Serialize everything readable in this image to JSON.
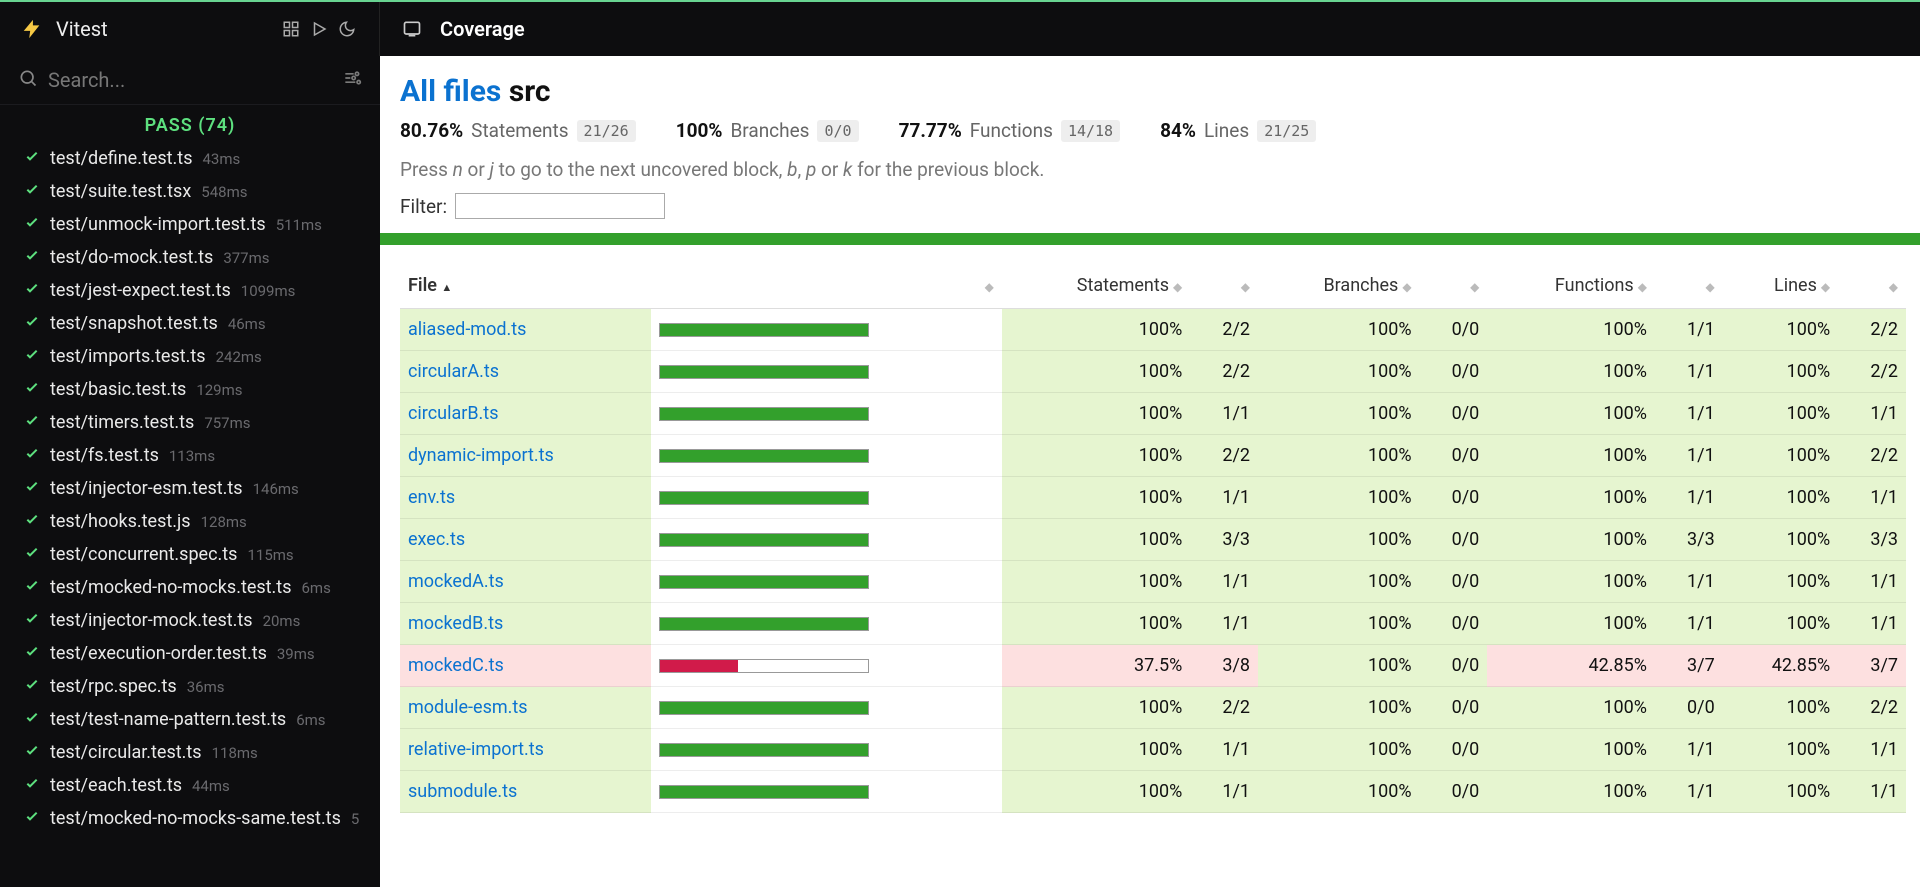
{
  "brand": {
    "name": "Vitest"
  },
  "topbar": {
    "coverage_label": "Coverage"
  },
  "search": {
    "placeholder": "Search..."
  },
  "status": {
    "text": "PASS (74)"
  },
  "tests": [
    {
      "path": "test/define.test.ts",
      "dur": "43ms"
    },
    {
      "path": "test/suite.test.tsx",
      "dur": "548ms"
    },
    {
      "path": "test/unmock-import.test.ts",
      "dur": "511ms"
    },
    {
      "path": "test/do-mock.test.ts",
      "dur": "377ms"
    },
    {
      "path": "test/jest-expect.test.ts",
      "dur": "1099ms"
    },
    {
      "path": "test/snapshot.test.ts",
      "dur": "46ms"
    },
    {
      "path": "test/imports.test.ts",
      "dur": "242ms"
    },
    {
      "path": "test/basic.test.ts",
      "dur": "129ms"
    },
    {
      "path": "test/timers.test.ts",
      "dur": "757ms"
    },
    {
      "path": "test/fs.test.ts",
      "dur": "113ms"
    },
    {
      "path": "test/injector-esm.test.ts",
      "dur": "146ms"
    },
    {
      "path": "test/hooks.test.js",
      "dur": "128ms"
    },
    {
      "path": "test/concurrent.spec.ts",
      "dur": "115ms"
    },
    {
      "path": "test/mocked-no-mocks.test.ts",
      "dur": "6ms"
    },
    {
      "path": "test/injector-mock.test.ts",
      "dur": "20ms"
    },
    {
      "path": "test/execution-order.test.ts",
      "dur": "39ms"
    },
    {
      "path": "test/rpc.spec.ts",
      "dur": "36ms"
    },
    {
      "path": "test/test-name-pattern.test.ts",
      "dur": "6ms"
    },
    {
      "path": "test/circular.test.ts",
      "dur": "118ms"
    },
    {
      "path": "test/each.test.ts",
      "dur": "44ms"
    },
    {
      "path": "test/mocked-no-mocks-same.test.ts",
      "dur": "5"
    }
  ],
  "crumb": {
    "root": "All files",
    "sub": "src"
  },
  "summary": {
    "statements": {
      "pct": "80.76%",
      "label": "Statements",
      "frac": "21/26"
    },
    "branches": {
      "pct": "100%",
      "label": "Branches",
      "frac": "0/0"
    },
    "functions": {
      "pct": "77.77%",
      "label": "Functions",
      "frac": "14/18"
    },
    "lines": {
      "pct": "84%",
      "label": "Lines",
      "frac": "21/25"
    }
  },
  "hint": {
    "prefix": "Press ",
    "k_next1": "n",
    "or1": " or ",
    "k_next2": "j",
    "mid": " to go to the next uncovered block, ",
    "k_prev1": "b",
    "comma": ", ",
    "k_prev2": "p",
    "or2": " or ",
    "k_prev3": "k",
    "suffix": " for the previous block."
  },
  "filter": {
    "label": "Filter:"
  },
  "headers": {
    "file": "File",
    "statements": "Statements",
    "branches": "Branches",
    "functions": "Functions",
    "lines": "Lines"
  },
  "rows": [
    {
      "file": "aliased-mod.ts",
      "stPct": "100%",
      "stBar": 100,
      "stFrac": "2/2",
      "brPct": "100%",
      "brFrac": "0/0",
      "fnPct": "100%",
      "fnFrac": "1/1",
      "lnPct": "100%",
      "lnFrac": "2/2",
      "low": false
    },
    {
      "file": "circularA.ts",
      "stPct": "100%",
      "stBar": 100,
      "stFrac": "2/2",
      "brPct": "100%",
      "brFrac": "0/0",
      "fnPct": "100%",
      "fnFrac": "1/1",
      "lnPct": "100%",
      "lnFrac": "2/2",
      "low": false
    },
    {
      "file": "circularB.ts",
      "stPct": "100%",
      "stBar": 100,
      "stFrac": "1/1",
      "brPct": "100%",
      "brFrac": "0/0",
      "fnPct": "100%",
      "fnFrac": "1/1",
      "lnPct": "100%",
      "lnFrac": "1/1",
      "low": false
    },
    {
      "file": "dynamic-import.ts",
      "stPct": "100%",
      "stBar": 100,
      "stFrac": "2/2",
      "brPct": "100%",
      "brFrac": "0/0",
      "fnPct": "100%",
      "fnFrac": "1/1",
      "lnPct": "100%",
      "lnFrac": "2/2",
      "low": false
    },
    {
      "file": "env.ts",
      "stPct": "100%",
      "stBar": 100,
      "stFrac": "1/1",
      "brPct": "100%",
      "brFrac": "0/0",
      "fnPct": "100%",
      "fnFrac": "1/1",
      "lnPct": "100%",
      "lnFrac": "1/1",
      "low": false
    },
    {
      "file": "exec.ts",
      "stPct": "100%",
      "stBar": 100,
      "stFrac": "3/3",
      "brPct": "100%",
      "brFrac": "0/0",
      "fnPct": "100%",
      "fnFrac": "3/3",
      "lnPct": "100%",
      "lnFrac": "3/3",
      "low": false
    },
    {
      "file": "mockedA.ts",
      "stPct": "100%",
      "stBar": 100,
      "stFrac": "1/1",
      "brPct": "100%",
      "brFrac": "0/0",
      "fnPct": "100%",
      "fnFrac": "1/1",
      "lnPct": "100%",
      "lnFrac": "1/1",
      "low": false
    },
    {
      "file": "mockedB.ts",
      "stPct": "100%",
      "stBar": 100,
      "stFrac": "1/1",
      "brPct": "100%",
      "brFrac": "0/0",
      "fnPct": "100%",
      "fnFrac": "1/1",
      "lnPct": "100%",
      "lnFrac": "1/1",
      "low": false
    },
    {
      "file": "mockedC.ts",
      "stPct": "37.5%",
      "stBar": 37.5,
      "stFrac": "3/8",
      "brPct": "100%",
      "brFrac": "0/0",
      "fnPct": "42.85%",
      "fnFrac": "3/7",
      "lnPct": "42.85%",
      "lnFrac": "3/7",
      "low": true
    },
    {
      "file": "module-esm.ts",
      "stPct": "100%",
      "stBar": 100,
      "stFrac": "2/2",
      "brPct": "100%",
      "brFrac": "0/0",
      "fnPct": "100%",
      "fnFrac": "0/0",
      "lnPct": "100%",
      "lnFrac": "2/2",
      "low": false
    },
    {
      "file": "relative-import.ts",
      "stPct": "100%",
      "stBar": 100,
      "stFrac": "1/1",
      "brPct": "100%",
      "brFrac": "0/0",
      "fnPct": "100%",
      "fnFrac": "1/1",
      "lnPct": "100%",
      "lnFrac": "1/1",
      "low": false
    },
    {
      "file": "submodule.ts",
      "stPct": "100%",
      "stBar": 100,
      "stFrac": "1/1",
      "brPct": "100%",
      "brFrac": "0/0",
      "fnPct": "100%",
      "fnFrac": "1/1",
      "lnPct": "100%",
      "lnFrac": "1/1",
      "low": false
    }
  ]
}
